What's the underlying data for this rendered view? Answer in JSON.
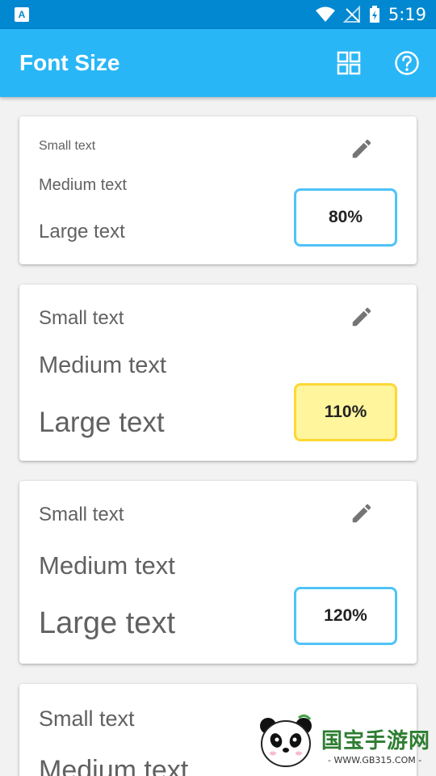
{
  "status_bar": {
    "app_icon_letter": "A",
    "time": "5:19"
  },
  "app_bar": {
    "title": "Font Size",
    "grid_icon": "grid-view-icon",
    "help_icon": "help-icon"
  },
  "cards": [
    {
      "small": "Small text",
      "medium": "Medium text",
      "large": "Large text",
      "percent": "80%",
      "selected": false
    },
    {
      "small": "Small text",
      "medium": "Medium text",
      "large": "Large text",
      "percent": "110%",
      "selected": true
    },
    {
      "small": "Small text",
      "medium": "Medium text",
      "large": "Large text",
      "percent": "120%",
      "selected": false
    },
    {
      "small": "Small text",
      "medium": "Medium text"
    }
  ],
  "watermark": {
    "text": "国宝手游网",
    "url": "- WWW.GB315.COM -"
  },
  "colors": {
    "status_bar": "#0288d1",
    "app_bar": "#29b6f6",
    "selected_fill": "#fff59d",
    "selected_border": "#fdd835",
    "unselected_border": "#4fc3f7"
  }
}
